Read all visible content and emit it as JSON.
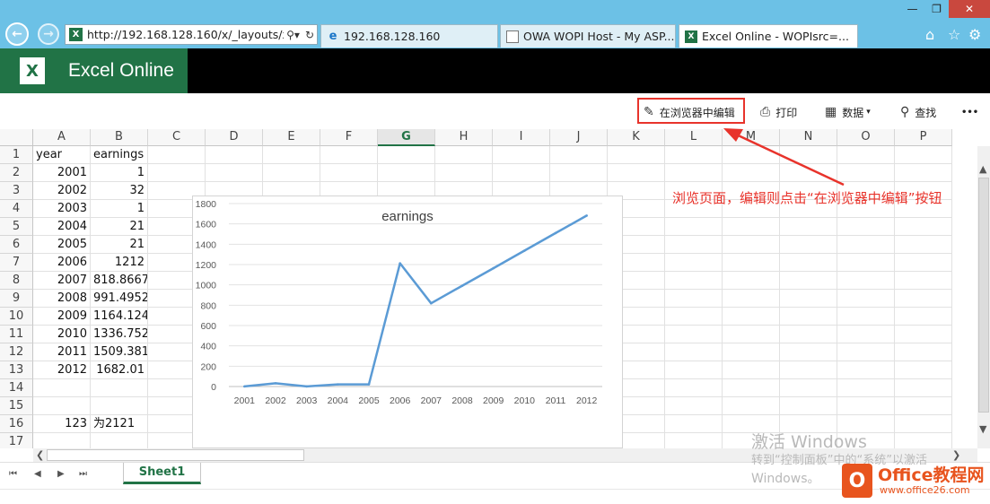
{
  "browser": {
    "address_url": "http://192.168.128.160/x/_layouts/x",
    "tabs": [
      {
        "label": "192.168.128.160"
      },
      {
        "label": "OWA WOPI Host - My ASP..."
      },
      {
        "label": "Excel Online - WOPIsrc=..."
      }
    ]
  },
  "app": {
    "name": "Excel Online"
  },
  "toolbar": {
    "edit_label": "在浏览器中编辑",
    "print_label": "打印",
    "data_label": "数据",
    "find_label": "查找",
    "more_label": "•••"
  },
  "columns": [
    "A",
    "B",
    "C",
    "D",
    "E",
    "F",
    "G",
    "H",
    "I",
    "J",
    "K",
    "L",
    "M",
    "N",
    "O",
    "P"
  ],
  "selected_column": "G",
  "rows": [
    {
      "n": "1",
      "a": "year",
      "b": "earnings"
    },
    {
      "n": "2",
      "a": "2001",
      "b": "1"
    },
    {
      "n": "3",
      "a": "2002",
      "b": "32"
    },
    {
      "n": "4",
      "a": "2003",
      "b": "1"
    },
    {
      "n": "5",
      "a": "2004",
      "b": "21"
    },
    {
      "n": "6",
      "a": "2005",
      "b": "21"
    },
    {
      "n": "7",
      "a": "2006",
      "b": "1212"
    },
    {
      "n": "8",
      "a": "2007",
      "b": "818.8667"
    },
    {
      "n": "9",
      "a": "2008",
      "b": "991.4952"
    },
    {
      "n": "10",
      "a": "2009",
      "b": "1164.124"
    },
    {
      "n": "11",
      "a": "2010",
      "b": "1336.752"
    },
    {
      "n": "12",
      "a": "2011",
      "b": "1509.381"
    },
    {
      "n": "13",
      "a": "2012",
      "b": "1682.01"
    },
    {
      "n": "14",
      "a": "",
      "b": ""
    },
    {
      "n": "15",
      "a": "",
      "b": ""
    },
    {
      "n": "16",
      "a": "123",
      "b": "为2121"
    },
    {
      "n": "17",
      "a": "",
      "b": ""
    }
  ],
  "chart_data": {
    "type": "line",
    "title": "earnings",
    "x": [
      "2001",
      "2002",
      "2003",
      "2004",
      "2005",
      "2006",
      "2007",
      "2008",
      "2009",
      "2010",
      "2011",
      "2012"
    ],
    "series": [
      {
        "name": "earnings",
        "values": [
          1,
          32,
          1,
          21,
          21,
          1212,
          818.8667,
          991.4952,
          1164.124,
          1336.752,
          1509.381,
          1682.01
        ],
        "color": "#5b9bd5"
      }
    ],
    "yticks": [
      "0",
      "200",
      "400",
      "600",
      "800",
      "1000",
      "1200",
      "1400",
      "1600",
      "1800"
    ],
    "ylim": [
      0,
      1800
    ],
    "grid": true
  },
  "sheet_tabs": [
    {
      "label": "Sheet1"
    }
  ],
  "annotation": {
    "text": "浏览页面，编辑则点击“在浏览器中编辑”按钮",
    "color": "#e8332b"
  },
  "watermark": {
    "line1": "激活 Windows",
    "line2": "转到“控制面板”中的“系统”以激活",
    "line3": "Windows。"
  },
  "site_logo": {
    "title": "Office教程网",
    "url": "www.office26.com"
  }
}
